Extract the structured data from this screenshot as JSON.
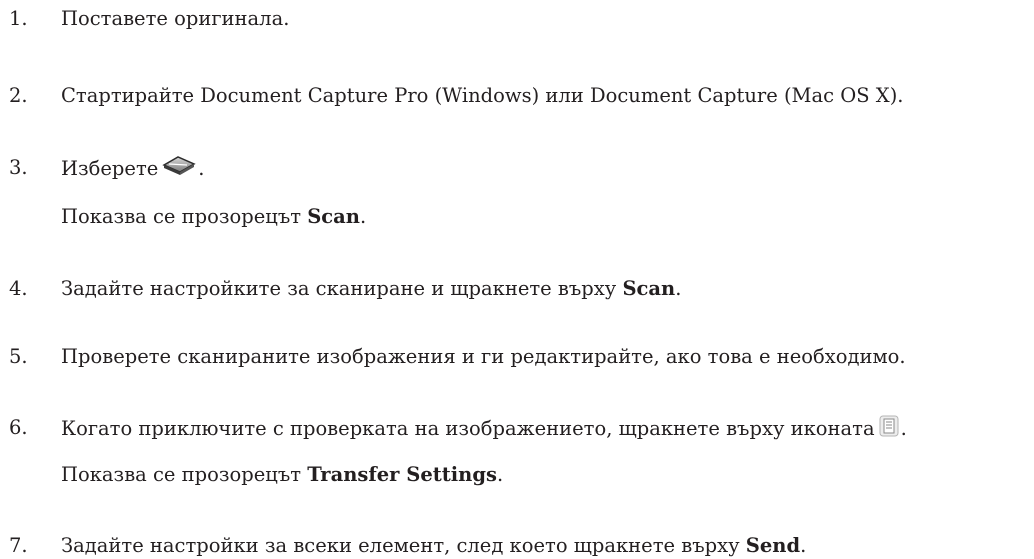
{
  "steps": [
    {
      "number": "1.",
      "text": "Поставете оригинала."
    },
    {
      "number": "2.",
      "text": "Стартирайте Document Capture Pro (Windows) или Document Capture (Mac OS X)."
    },
    {
      "number": "3.",
      "text_before": "Изберете",
      "text_after": ".",
      "icon": "scan-icon",
      "note_before": "Показва се прозорецът ",
      "note_bold": "Scan",
      "note_after": "."
    },
    {
      "number": "4.",
      "text_before": "Задайте настройките за сканиране и щракнете върху ",
      "bold": "Scan",
      "text_after": "."
    },
    {
      "number": "5.",
      "text": "Проверете сканираните изображения и ги редактирайте, ако това е необходимо."
    },
    {
      "number": "6.",
      "text_before": "Когато приключите с проверката на изображението, щракнете върху иконата",
      "text_after": ".",
      "icon": "transfer-document-icon",
      "note_before": "Показва се прозорецът ",
      "note_bold": "Transfer Settings",
      "note_after": "."
    },
    {
      "number": "7.",
      "text_before": "Задайте настройки за всеки елемент, след което щракнете върху ",
      "bold": "Send",
      "text_after": "."
    }
  ]
}
